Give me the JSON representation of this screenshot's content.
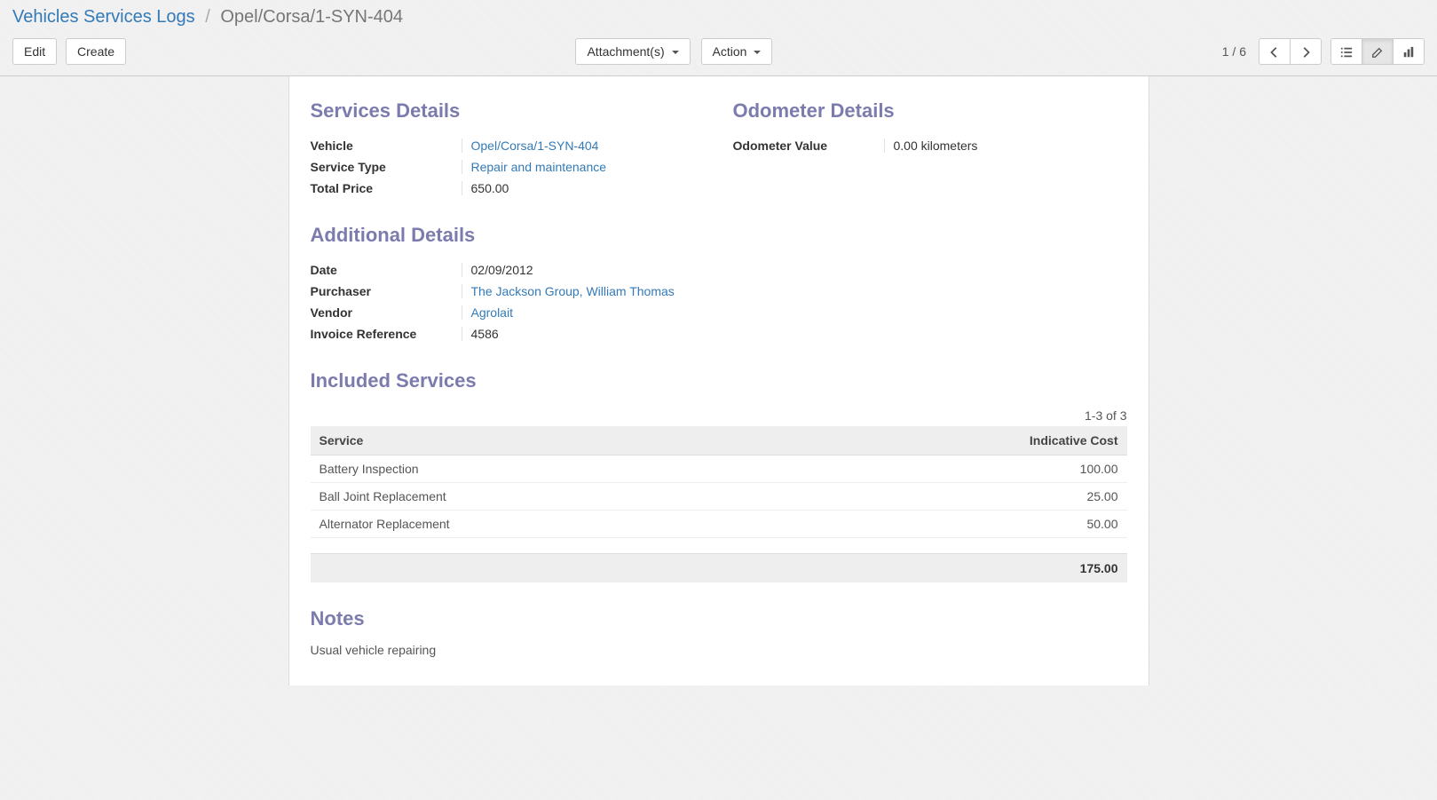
{
  "breadcrumb": {
    "root": "Vehicles Services Logs",
    "current": "Opel/Corsa/1-SYN-404"
  },
  "toolbar": {
    "edit": "Edit",
    "create": "Create",
    "attachments": "Attachment(s)",
    "action": "Action",
    "pager": "1 / 6"
  },
  "services_details": {
    "heading": "Services Details",
    "vehicle_label": "Vehicle",
    "vehicle_value": "Opel/Corsa/1-SYN-404",
    "service_type_label": "Service Type",
    "service_type_value": "Repair and maintenance",
    "total_price_label": "Total Price",
    "total_price_value": "650.00"
  },
  "odometer_details": {
    "heading": "Odometer Details",
    "odometer_label": "Odometer Value",
    "odometer_value": "0.00",
    "odometer_unit": "kilometers"
  },
  "additional_details": {
    "heading": "Additional Details",
    "date_label": "Date",
    "date_value": "02/09/2012",
    "purchaser_label": "Purchaser",
    "purchaser_value": "The Jackson Group, William Thomas",
    "vendor_label": "Vendor",
    "vendor_value": "Agrolait",
    "invoice_ref_label": "Invoice Reference",
    "invoice_ref_value": "4586"
  },
  "included_services": {
    "heading": "Included Services",
    "pager": "1-3 of 3",
    "col_service": "Service",
    "col_cost": "Indicative Cost",
    "rows": [
      {
        "service": "Battery Inspection",
        "cost": "100.00"
      },
      {
        "service": "Ball Joint Replacement",
        "cost": "25.00"
      },
      {
        "service": "Alternator Replacement",
        "cost": "50.00"
      }
    ],
    "total": "175.00"
  },
  "notes": {
    "heading": "Notes",
    "text": "Usual vehicle repairing"
  }
}
